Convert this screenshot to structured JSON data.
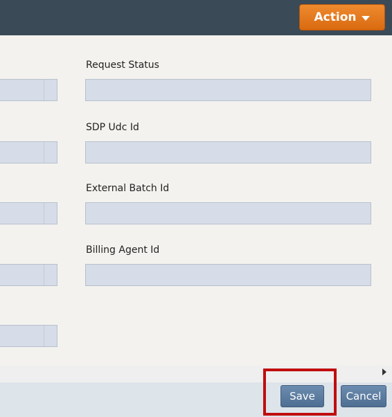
{
  "header": {
    "action_label": "Action"
  },
  "form": {
    "fields": [
      {
        "label": "Request Status",
        "value": ""
      },
      {
        "label": "SDP Udc Id",
        "value": ""
      },
      {
        "label": "External Batch Id",
        "value": ""
      },
      {
        "label": "Billing Agent Id",
        "value": ""
      }
    ]
  },
  "footer": {
    "save_label": "Save",
    "cancel_label": "Cancel"
  },
  "colors": {
    "header_bg": "#3b4a57",
    "action_orange": "#e07a1f",
    "button_blue": "#5b7ca0",
    "highlight_red": "#c00d0d",
    "field_bg": "#d6dde8"
  },
  "icons": [
    "chevron-down-icon",
    "scroll-right-arrow-icon"
  ]
}
